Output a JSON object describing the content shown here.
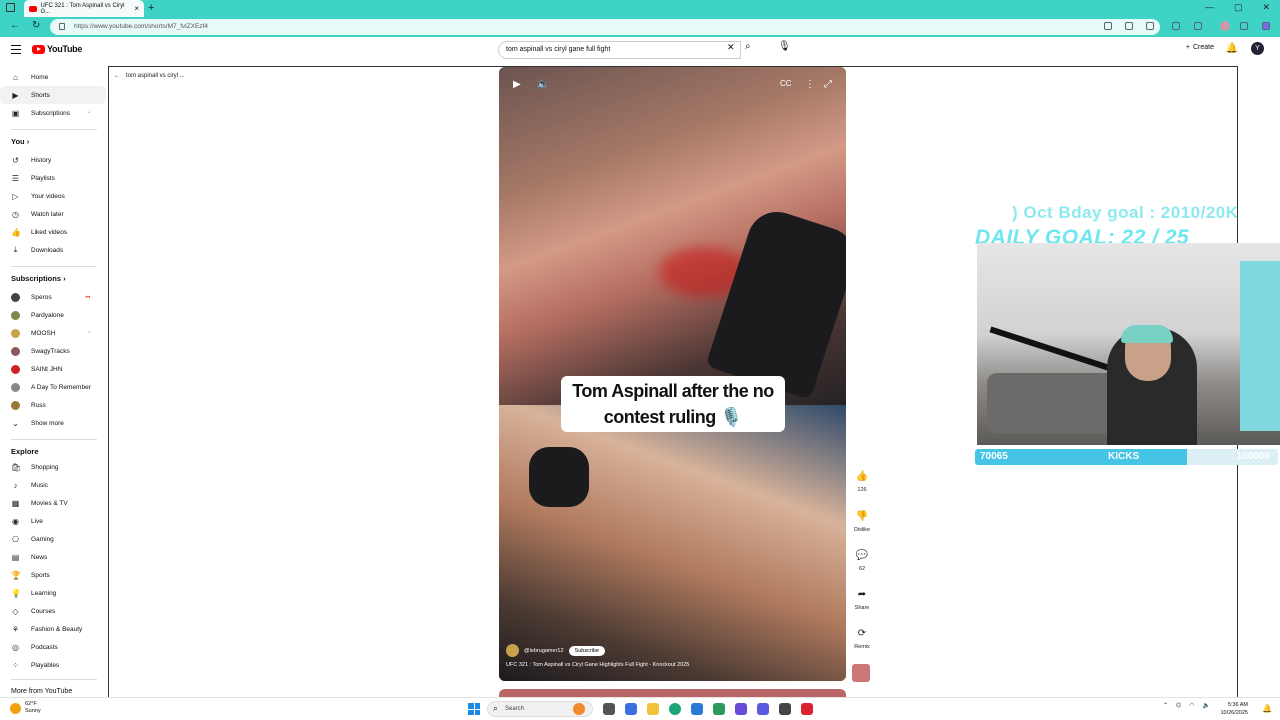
{
  "browser": {
    "tab_title": "UFC 321 : Tom Aspinall vs Ciryl G...",
    "url": "https://www.youtube.com/shorts/M7_fvlZXEzf4"
  },
  "header": {
    "logo_text": "YouTube",
    "search_value": "tom aspinall vs ciryl gane full fight",
    "create_label": "Create",
    "avatar_letter": "Y"
  },
  "sidebar": {
    "main": [
      {
        "label": "Home",
        "icon": "⌂"
      },
      {
        "label": "Shorts",
        "icon": "▶"
      },
      {
        "label": "Subscriptions",
        "icon": "▣"
      }
    ],
    "you_heading": "You",
    "you_items": [
      {
        "label": "History",
        "icon": "↺"
      },
      {
        "label": "Playlists",
        "icon": "☰"
      },
      {
        "label": "Your videos",
        "icon": "▷"
      },
      {
        "label": "Watch later",
        "icon": "◷"
      },
      {
        "label": "Liked videos",
        "icon": "👍"
      },
      {
        "label": "Downloads",
        "icon": "⤓"
      }
    ],
    "subs_heading": "Subscriptions",
    "subscriptions": [
      {
        "label": "Speros",
        "color": "#444"
      },
      {
        "label": "Pardyalone",
        "color": "#7a8a4a"
      },
      {
        "label": "MOOSH",
        "color": "#c8a24a"
      },
      {
        "label": "SwagyTracks",
        "color": "#8a5a5a"
      },
      {
        "label": "SAINt JHN",
        "color": "#c22"
      },
      {
        "label": "A Day To Remember",
        "color": "#888"
      },
      {
        "label": "Russ",
        "color": "#9a7a3a"
      }
    ],
    "show_more": "Show more",
    "explore_heading": "Explore",
    "explore": [
      {
        "label": "Shopping",
        "icon": "🛍"
      },
      {
        "label": "Music",
        "icon": "♪"
      },
      {
        "label": "Movies & TV",
        "icon": "▦"
      },
      {
        "label": "Live",
        "icon": "◉"
      },
      {
        "label": "Gaming",
        "icon": "⎔"
      },
      {
        "label": "News",
        "icon": "▤"
      },
      {
        "label": "Sports",
        "icon": "🏆"
      },
      {
        "label": "Learning",
        "icon": "💡"
      },
      {
        "label": "Courses",
        "icon": "◇"
      },
      {
        "label": "Fashion & Beauty",
        "icon": "⚘"
      },
      {
        "label": "Podcasts",
        "icon": "◎"
      },
      {
        "label": "Playables",
        "icon": "⁘"
      }
    ],
    "more_heading": "More from YouTube"
  },
  "main": {
    "back_label": "tom aspinall vs ciryl ..."
  },
  "video": {
    "caption_line1": "Tom Aspinall after the no",
    "caption_line2": "contest ruling 🎙️",
    "channel": "@lebrugamer12",
    "subscribe": "Subscribe",
    "title": "UFC 321 : Tom Aspinall vs Ciryl Gane Highlights Full Fight - Knockout 2025"
  },
  "actions": {
    "like_count": "126",
    "dislike_label": "Dislike",
    "comment_count": "62",
    "share_label": "Share",
    "remix_label": "Remix"
  },
  "overlay": {
    "goal_line1": ") Oct Bday goal : 2010/20K",
    "goal_line2": "DAILY GOAL: 22 / 25",
    "kicks_current": "70065",
    "kicks_label": "KICKS",
    "kicks_target": "100000",
    "kicks_progress": 0.7
  },
  "taskbar": {
    "temp": "62°F",
    "condition": "Sunny",
    "search_placeholder": "Search",
    "time": "5:36 AM",
    "date": "10/26/2025"
  }
}
